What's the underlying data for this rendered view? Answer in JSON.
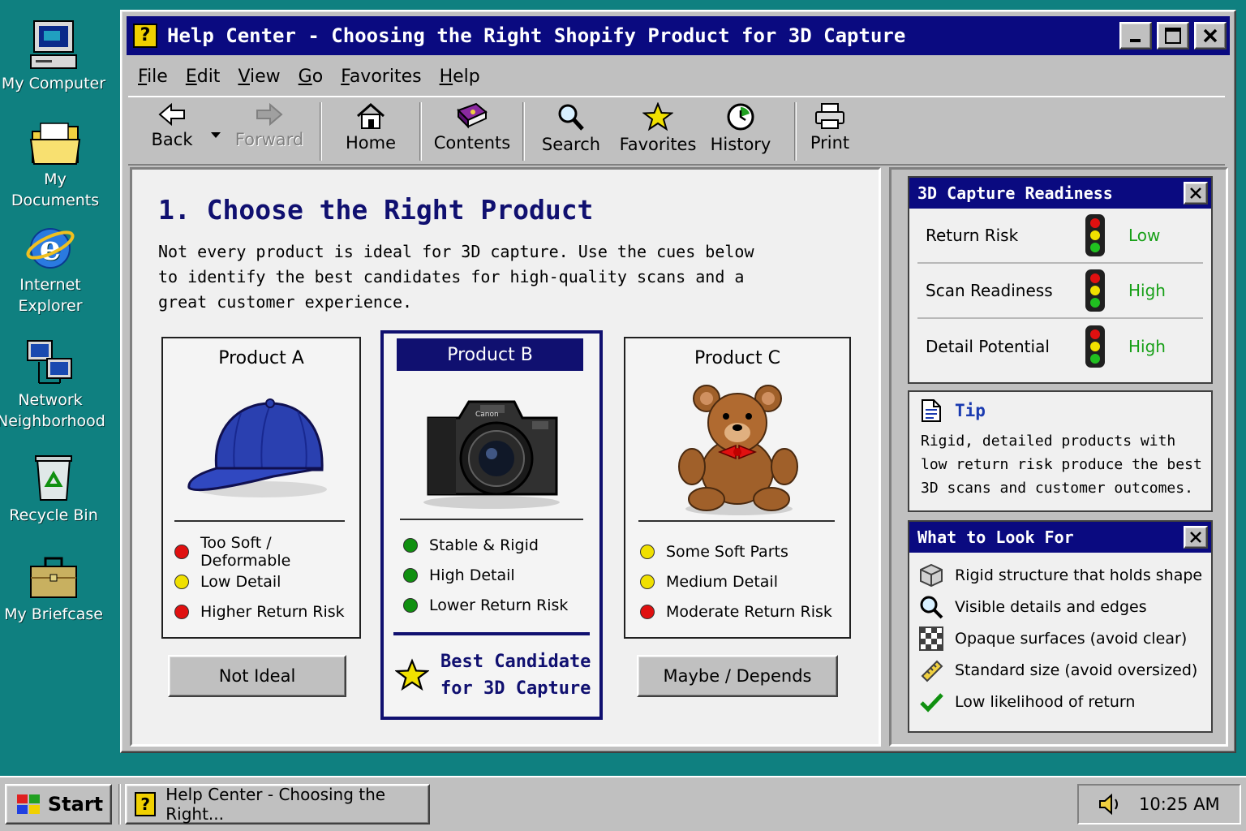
{
  "desktop": {
    "icons": [
      {
        "label": "My Computer",
        "icon": "computer-icon"
      },
      {
        "label": "My Documents",
        "icon": "folder-icon"
      },
      {
        "label": "Internet\nExplorer",
        "icon": "internet-explorer-icon"
      },
      {
        "label": "Network\nNeighborhood",
        "icon": "network-icon"
      },
      {
        "label": "Recycle Bin",
        "icon": "recycle-bin-icon"
      },
      {
        "label": "My Briefcase",
        "icon": "briefcase-icon"
      }
    ]
  },
  "window": {
    "title": "Help Center - Choosing the Right Shopify Product for 3D Capture",
    "menu": [
      "File",
      "Edit",
      "View",
      "Go",
      "Favorites",
      "Help"
    ],
    "toolbar": {
      "back": "Back",
      "forward": "Forward",
      "home": "Home",
      "contents": "Contents",
      "search": "Search",
      "favorites": "Favorites",
      "history": "History",
      "print": "Print"
    }
  },
  "page": {
    "title": "1. Choose the Right Product",
    "intro": "Not every product is ideal for 3D capture. Use the cues below to identify the best candidates for high-quality scans and a great customer experience.",
    "products": [
      {
        "name": "Product A",
        "image": "baseball-cap",
        "traits": [
          {
            "label": "Too Soft / Deformable",
            "status": "red"
          },
          {
            "label": "Low Detail",
            "status": "yellow"
          },
          {
            "label": "Higher Return Risk",
            "status": "red"
          }
        ],
        "verdict": "Not Ideal"
      },
      {
        "name": "Product B",
        "image": "camera",
        "traits": [
          {
            "label": "Stable & Rigid",
            "status": "green"
          },
          {
            "label": "High Detail",
            "status": "green"
          },
          {
            "label": "Lower Return Risk",
            "status": "green"
          }
        ],
        "verdict_line1": "Best Candidate",
        "verdict_line2": "for 3D Capture",
        "camera_brand": "Canon"
      },
      {
        "name": "Product C",
        "image": "teddy-bear",
        "traits": [
          {
            "label": "Some Soft Parts",
            "status": "yellow"
          },
          {
            "label": "Medium Detail",
            "status": "yellow"
          },
          {
            "label": "Moderate Return Risk",
            "status": "red"
          }
        ],
        "verdict": "Maybe / Depends"
      }
    ]
  },
  "readiness": {
    "title": "3D Capture Readiness",
    "rows": [
      {
        "label": "Return Risk",
        "value": "Low",
        "light": "green"
      },
      {
        "label": "Scan Readiness",
        "value": "High",
        "light": "green"
      },
      {
        "label": "Detail Potential",
        "value": "High",
        "light": "green"
      }
    ]
  },
  "tip": {
    "title": "Tip",
    "text": "Rigid, detailed products with low return risk produce the best 3D scans and customer outcomes."
  },
  "look_for": {
    "title": "What to Look For",
    "items": [
      {
        "label": "Rigid structure that holds shape",
        "icon": "cube-icon"
      },
      {
        "label": "Visible details and edges",
        "icon": "magnifier-icon"
      },
      {
        "label": "Opaque surfaces (avoid clear)",
        "icon": "checker-icon"
      },
      {
        "label": "Standard size (avoid oversized)",
        "icon": "ruler-icon"
      },
      {
        "label": "Low likelihood of return",
        "icon": "checkmark-icon"
      }
    ]
  },
  "taskbar": {
    "start": "Start",
    "task": "Help Center - Choosing the Right...",
    "clock": "10:25 AM"
  },
  "colors": {
    "desktop": "#0f8080",
    "titlebar": "#0a0a80",
    "heading": "#101070",
    "red": "#e01010",
    "yellow": "#f0e000",
    "green": "#109010",
    "value_green": "#18a018"
  }
}
